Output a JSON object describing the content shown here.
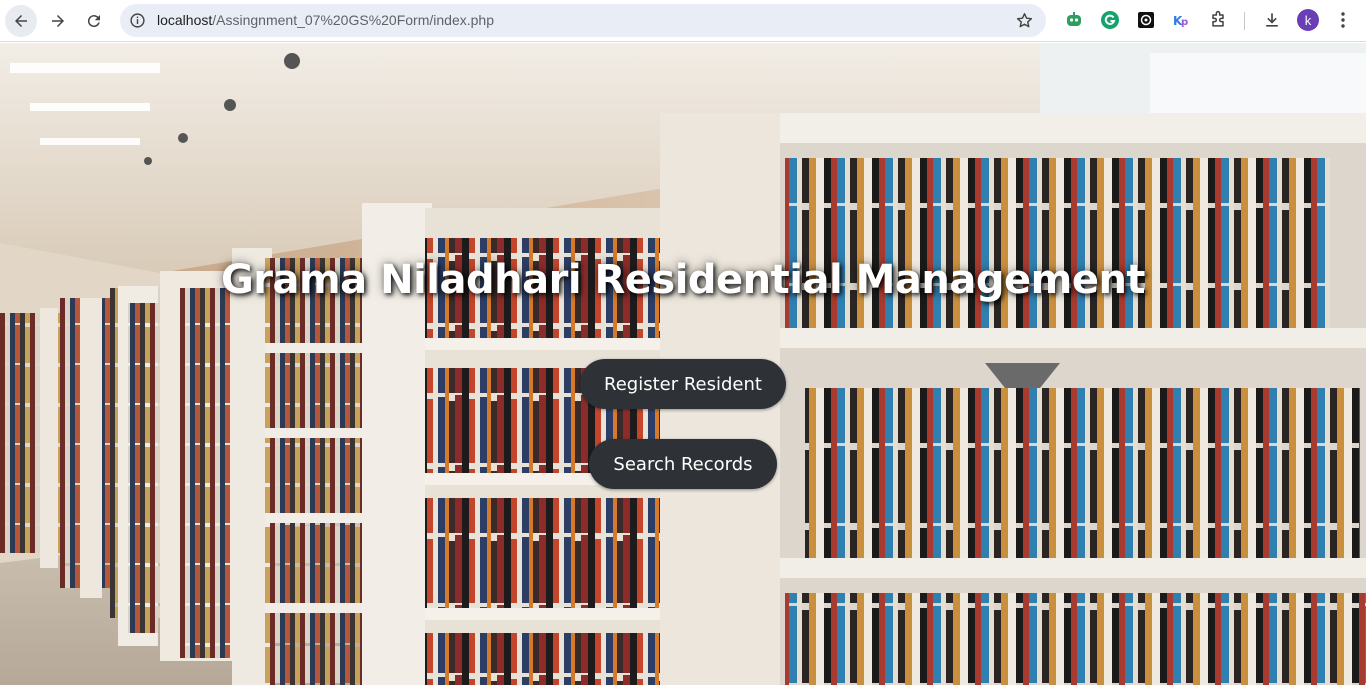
{
  "browser": {
    "url_host": "localhost",
    "url_path": "/Assingnment_07%20GS%20Form/index.php",
    "profile_initial": "k"
  },
  "page": {
    "title": "Grama Niladhari Residential Management",
    "buttons": {
      "register": "Register Resident",
      "search": "Search Records"
    }
  },
  "colors": {
    "button_bg": "#2e3236",
    "title_text": "#ffffff",
    "avatar_bg": "#6a3fb5"
  },
  "icons": [
    "back-arrow-icon",
    "forward-arrow-icon",
    "reload-icon",
    "info-icon",
    "star-icon",
    "robot-extension-icon",
    "grammarly-icon",
    "chatgpt-icon",
    "kp-extension-icon",
    "puzzle-icon",
    "download-icon",
    "menu-dots-icon"
  ]
}
